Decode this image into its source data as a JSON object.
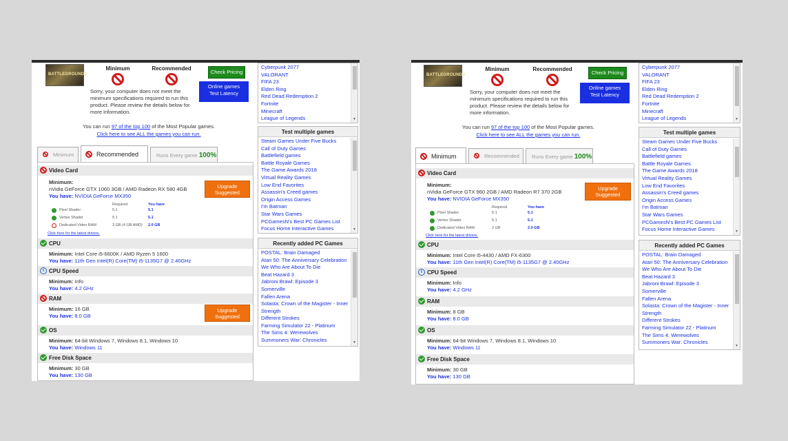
{
  "common": {
    "minimum_label": "Minimum",
    "recommended_label": "Recommended",
    "check_pricing": "Check Pricing",
    "online_games": "Online games",
    "test_latency": "Test Latency",
    "message": "Sorry, your computer does not meet the minimum specifications required to run this product. Please review the details below for more information.",
    "run_prefix": "You can run ",
    "run_link": "97 of the top 100",
    "run_suffix": " of the Most Popular games.",
    "see_all_link": "Click here to see ALL the games you can run.",
    "tab_minimum": "Minimum",
    "tab_recommended": "Recommended",
    "tab_runs": "Runs Every game",
    "tab_runs_pct": "100%",
    "upgrade_line1": "Upgrade",
    "upgrade_line2": "Suggested",
    "logo_text": "BATTLEGROUNDS",
    "required_label": "Required",
    "you_have_label": "You have",
    "pixel_shader": "Pixel Shader",
    "vertex_shader": "Vertex Shader",
    "dedicated_vram": "Dedicated Video RAM",
    "driver_link": "Click here for the latest drivers.",
    "minimum_prefix": "Minimum: ",
    "minimum_colon": "Minimum:",
    "you_have_prefix": "You have: ",
    "sec_video": "Video Card",
    "sec_cpu": "CPU",
    "sec_cpu_speed": "CPU Speed",
    "sec_ram": "RAM",
    "sec_os": "OS",
    "sec_disk": "Free Disk Space",
    "popular_games": [
      "Cyberpunk 2077",
      "VALORANT",
      "FIFA 23",
      "Elden Ring",
      "Red Dead Redemption 2",
      "Fortnite",
      "Minecraft",
      "League of Legends"
    ],
    "test_multiple_header": "Test multiple games",
    "test_multiple": [
      "Steam Games Under Five Bucks",
      "Call of Duty Games",
      "Battlefield games",
      "Battle Royale Games",
      "The Game Awards 2018",
      "Virtual Reality Games",
      "Low End Favorites",
      "Assassin's Creed games",
      "Origin Access Games",
      "I'm Batman",
      "Star Wars Games",
      "PCGamesN's Best PC Games List",
      "Focus Home Interactive Games"
    ],
    "recent_header": "Recently added PC Games",
    "recent_left": [
      "POSTAL: Brain Damaged",
      "Atari 50: The Anniversary Celebration",
      "We Who Are About To Die",
      "Beat Hazard 3",
      "Jabroni Brawl: Episode 3",
      "Somerville",
      "Fallen Arena",
      "Solasta: Crown of the Magister - Inner Strength",
      "Different Strokes",
      "Farming Simulator 22 - Platinum",
      "The Sims 4: Werewolves",
      "Summoners War: Chronicles"
    ],
    "recent_right": [
      "POSTAL: Brain Damaged",
      "Atari 50: The Anniversary Celebration",
      "We Who Are About To Die",
      "Beat Hazard 3",
      "Jabroni Brawl: Episode 3",
      "Somerville",
      "Fallen Arena",
      "Solasta: Crown of the Magister - Inner",
      "Strength",
      "Different Strokes",
      "Farming Simulator 22 - Platinum",
      "The Sims 4: Werewolves",
      "Summoners War: Chronicles"
    ]
  },
  "left": {
    "video_min": "nVidia GeForce GTX 1060 3GB / AMD Radeon RX 580 4GB",
    "video_have": "NVIDIA GeForce MX350",
    "ps_req": "5.1",
    "ps_have": "5.1",
    "vs_req": "5.1",
    "vs_have": "5.1",
    "vram_req": "3 GB (4 GB AMD)",
    "vram_have": "2.0 GB",
    "cpu_min": "Intel Core i5-6600K / AMD Ryzen 5 1600",
    "cpu_have": "11th Gen Intel(R) Core(TM) i5-1135G7 @ 2.40GHz",
    "speed_min": "Info",
    "speed_have": "4.2 GHz",
    "ram_min": "16 GB",
    "ram_have": "8.0 GB",
    "os_min": "64-bit Windows 7, Windows 8.1, Windows 10",
    "os_have": "Windows 11",
    "disk_min": "30 GB",
    "disk_have": "130 GB"
  },
  "right": {
    "video_min": "nVidia GeForce GTX 960 2GB / AMD Radeon R7 370 2GB",
    "video_have": "NVIDIA GeForce MX350",
    "ps_req": "5.1",
    "ps_have": "5.1",
    "vs_req": "5.1",
    "vs_have": "5.1",
    "vram_req": "2 GB",
    "vram_have": "2.0 GB",
    "cpu_min": "Intel Core i5-4430 / AMD FX-6300",
    "cpu_have": "11th Gen Intel(R) Core(TM) i5-1135G7 @ 2.40GHz",
    "speed_min": "Info",
    "speed_have": "4.2 GHz",
    "ram_min": "8 GB",
    "ram_have": "8.0 GB",
    "os_min": "64-bit Windows 7, Windows 8.1, Windows 10",
    "os_have": "Windows 11",
    "disk_min": "30 GB",
    "disk_have": "130 GB"
  }
}
